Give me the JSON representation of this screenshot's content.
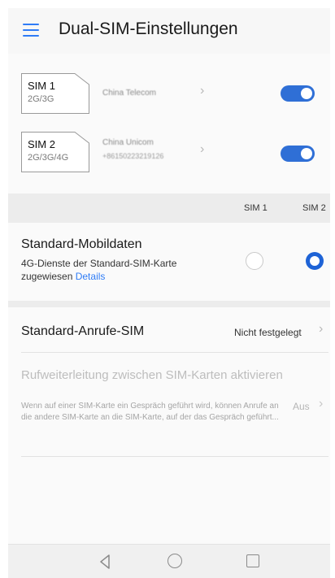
{
  "header": {
    "title": "Dual-SIM-Einstellungen",
    "menu_icon": "menu-icon"
  },
  "sims": [
    {
      "name": "SIM 1",
      "tech": "2G/3G",
      "carrier": "China Telecom",
      "number": "",
      "enabled": true
    },
    {
      "name": "SIM 2",
      "tech": "2G/3G/4G",
      "carrier": "China Unicom",
      "number": "+86150223219126",
      "enabled": true
    }
  ],
  "columns": {
    "sim1": "SIM 1",
    "sim2": "SIM 2"
  },
  "mobile_data": {
    "title": "Standard-Mobildaten",
    "desc": "4G-Dienste der Standard-SIM-Karte zugewiesen",
    "link": "Details",
    "selected": "SIM 2"
  },
  "default_calls": {
    "title": "Standard-Anrufe-SIM",
    "value": "Nicht festgelegt"
  },
  "call_forwarding": {
    "title": "Rufweiterleitung zwischen SIM-Karten aktivieren",
    "desc": "Wenn auf einer SIM-Karte ein Gespräch geführt wird, können Anrufe an die andere SIM-Karte an die SIM-Karte, auf der das Gespräch geführt...",
    "value": "Aus",
    "enabled": false
  },
  "colors": {
    "accent": "#2f7cf6",
    "toggle": "#2f6fd6",
    "band": "#ececec"
  },
  "navbar": {
    "icons": [
      "back-icon",
      "home-icon",
      "recents-icon"
    ]
  }
}
